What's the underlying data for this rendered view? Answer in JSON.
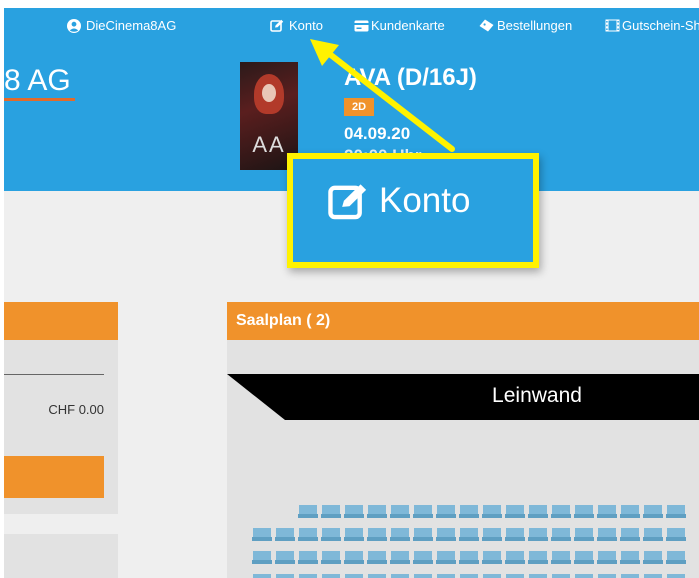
{
  "topnav": {
    "items": [
      {
        "label": "DieCinema8AG",
        "icon": "user-circle-icon"
      },
      {
        "label": "Konto",
        "icon": "edit-icon"
      },
      {
        "label": "Kundenkarte",
        "icon": "card-icon"
      },
      {
        "label": "Bestellungen",
        "icon": "ticket-icon"
      },
      {
        "label": "Gutschein-Sh",
        "icon": "film-icon"
      }
    ]
  },
  "header": {
    "brand": "8 AG",
    "poster_text": "AA",
    "movie_title": "AVA (D/16J)",
    "format_badge": "2D",
    "date": "04.09.20",
    "time": "20:00 Uhr"
  },
  "left_panel": {
    "price": "CHF 0.00"
  },
  "saalplan": {
    "title": "Saalplan ( 2)",
    "screen_label": "Leinwand"
  },
  "callout": {
    "label": "Konto",
    "icon": "edit-icon"
  },
  "colors": {
    "primary": "#29a1e0",
    "accent": "#f0922b",
    "highlight": "#fff200",
    "seat": "#7fb8d8"
  }
}
